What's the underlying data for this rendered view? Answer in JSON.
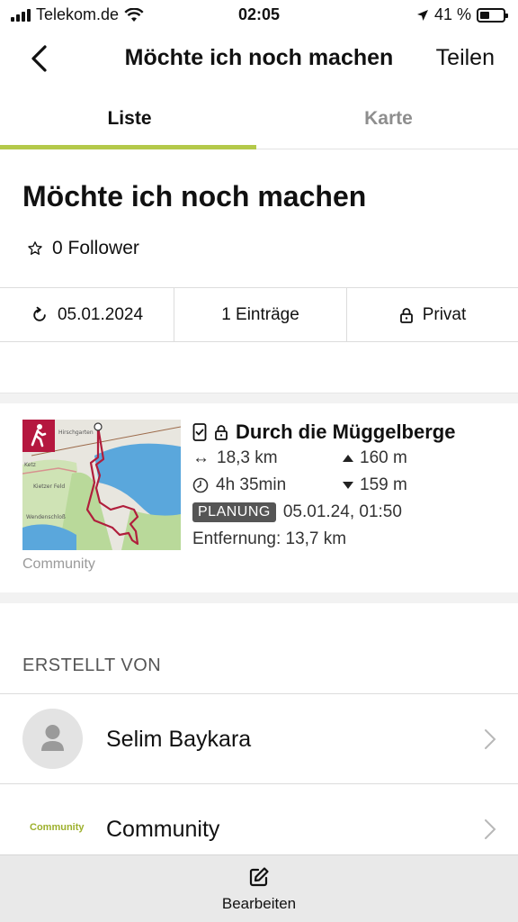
{
  "status_bar": {
    "carrier": "Telekom.de",
    "time": "02:05",
    "battery_text": "41 %",
    "battery_level": 0.41
  },
  "nav": {
    "title": "Möchte ich noch machen",
    "share_label": "Teilen"
  },
  "tabs": [
    {
      "label": "Liste",
      "active": true
    },
    {
      "label": "Karte",
      "active": false
    }
  ],
  "list": {
    "title": "Möchte ich noch machen",
    "followers": "0 Follower",
    "date": "05.01.2024",
    "entries": "1 Einträge",
    "visibility": "Privat"
  },
  "tour": {
    "title": "Durch die Müggelberge",
    "distance": "18,3 km",
    "ascent": "160 m",
    "duration": "4h 35min",
    "descent": "159 m",
    "status_badge": "PLANUNG",
    "planned_date": "05.01.24, 01:50",
    "proximity": "Entfernung: 13,7 km",
    "source": "Community",
    "map_labels": [
      "Hirschgarten",
      "Ketz",
      "Kietzer Feld",
      "Wendenschloß"
    ]
  },
  "created_by": {
    "header": "ERSTELLT VON",
    "items": [
      {
        "name": "Selim Baykara"
      },
      {
        "name": "Community",
        "logo_text": "Community"
      }
    ]
  },
  "toolbar": {
    "edit_label": "Bearbeiten"
  },
  "colors": {
    "accent": "#b4c94a",
    "hike_badge": "#b5173f",
    "route": "#b01e3c",
    "water": "#5aa7dc"
  }
}
